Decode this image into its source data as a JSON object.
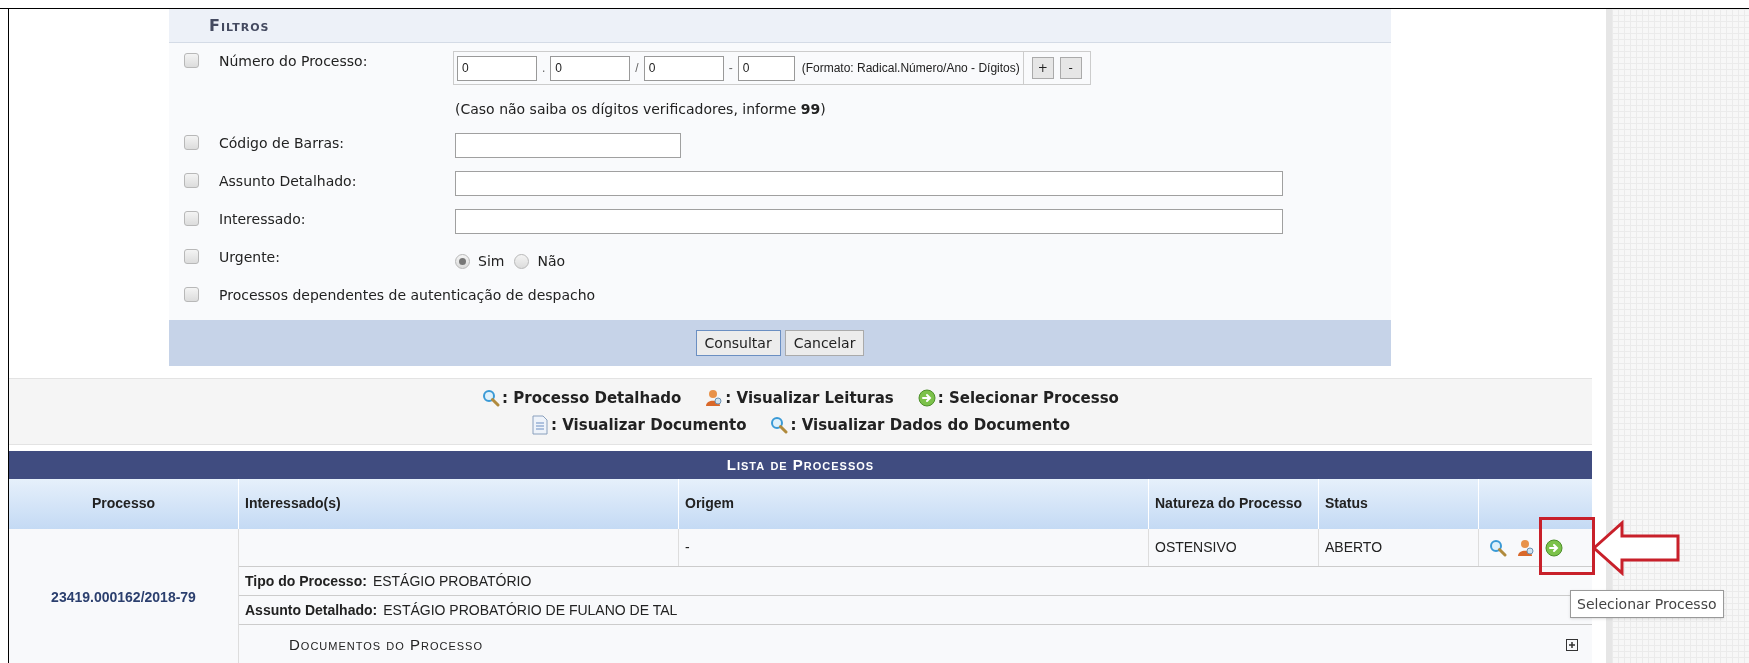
{
  "filters": {
    "title": "Filtros",
    "rows": [
      {
        "kind": "process_number",
        "checked": false,
        "label": "Número do Processo:",
        "parts": [
          {
            "value": "0"
          },
          {
            "sep": ".",
            "value": "0"
          },
          {
            "sep": "/",
            "value": "0"
          },
          {
            "sep": "-",
            "value": "0"
          }
        ],
        "format": "(Formato: Radical.Número/Ano - Dígitos)",
        "buttons": [
          "+",
          "-"
        ],
        "hint": "(Caso não saiba os dígitos verificadores, informe **99**)"
      },
      {
        "kind": "short_text",
        "checked": false,
        "label": "Código de Barras:"
      },
      {
        "kind": "long_text",
        "checked": false,
        "label": "Assunto Detalhado:"
      },
      {
        "kind": "long_text",
        "checked": false,
        "label": "Interessado:"
      },
      {
        "kind": "radio",
        "checked": false,
        "label": "Urgente:",
        "options": [
          {
            "label": "Sim",
            "selected": true
          },
          {
            "label": "Não",
            "selected": false
          }
        ]
      },
      {
        "kind": "check",
        "checked": false,
        "label": "Processos dependentes de autenticação de despacho"
      }
    ],
    "buttons": [
      "Consultar",
      "Cancelar"
    ]
  },
  "legend": [
    [
      {
        "kind": "magnifier",
        "label": ": Processo Detalhado"
      },
      {
        "kind": "person",
        "label": ": Visualizar Leituras"
      },
      {
        "kind": "go",
        "label": ": Selecionar Processo"
      }
    ],
    [
      {
        "kind": "document",
        "label": ": Visualizar Documento"
      },
      {
        "kind": "magnifier",
        "label": ": Visualizar Dados do Documento"
      }
    ]
  ],
  "table": {
    "title": "Lista de Processos",
    "columns": [
      "Processo",
      "Interessado(s)",
      "Origem",
      "Natureza do Processo",
      "Status"
    ],
    "rows": [
      {
        "processo": "23419.000162/2018-79",
        "interessado": "",
        "origem": "-",
        "natureza": "OSTENSIVO",
        "status": "ABERTO",
        "actions": [
          {
            "kind": "magnifier"
          },
          {
            "kind": "person"
          },
          {
            "kind": "go"
          }
        ],
        "details": [
          {
            "label": "Tipo do Processo:",
            "value": "ESTÁGIO PROBATÓRIO"
          },
          {
            "label": "Assunto Detalhado:",
            "value": "ESTÁGIO PROBATÓRIO DE FULANO DE TAL"
          }
        ],
        "documents": {
          "title": "Documentos do Processo",
          "expanded": false
        }
      }
    ]
  },
  "tooltip": "Selecionar Processo"
}
